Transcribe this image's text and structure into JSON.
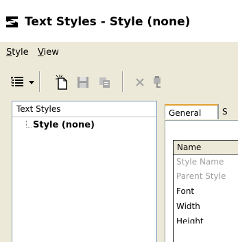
{
  "window": {
    "title": "Text Styles - Style (none)",
    "app_icon": "text-style-app-icon"
  },
  "menu": {
    "items": [
      {
        "label": "Style",
        "mnemonic": "S",
        "rest": "tyle"
      },
      {
        "label": "View",
        "mnemonic": "V",
        "rest": "iew"
      }
    ]
  },
  "toolbar": {
    "buttons": [
      "list-view-icon",
      "new-style-icon",
      "save-icon",
      "copy-icon",
      "delete-icon",
      "paste-icon"
    ]
  },
  "left_pane": {
    "header": "Text Styles",
    "tree_items": [
      "Style (none)"
    ]
  },
  "tabs": {
    "active": "General",
    "next": "S"
  },
  "grid": {
    "header": "Name",
    "rows": [
      {
        "label": "Style Name",
        "disabled": true
      },
      {
        "label": "Parent Style",
        "disabled": true
      },
      {
        "label": "Font",
        "disabled": false
      },
      {
        "label": "Width",
        "disabled": false
      },
      {
        "label": "Height",
        "disabled": false
      }
    ]
  },
  "colors": {
    "chrome": "#ece9d8",
    "pane_border": "#7f9db9",
    "disabled_text": "#a0a0a0",
    "tab_highlight": "#e0a030"
  }
}
